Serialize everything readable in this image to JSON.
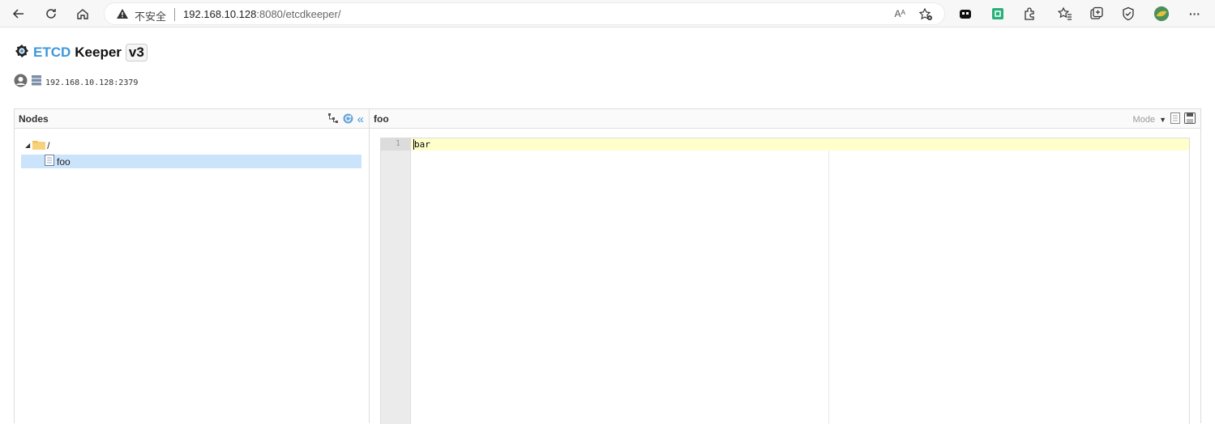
{
  "browser": {
    "insecure_label": "不安全",
    "url_host": "192.168.10.128",
    "url_rest": ":8080/etcdkeeper/",
    "read_aloud": "Aᴬ",
    "more": "···"
  },
  "app": {
    "title_etcd": "ETCD",
    "title_keeper": "Keeper",
    "version": "v3",
    "host": "192.168.10.128:2379"
  },
  "nodes_panel": {
    "title": "Nodes",
    "collapse": "«",
    "root_label": "/",
    "items": [
      {
        "label": "foo",
        "selected": true
      }
    ]
  },
  "editor_panel": {
    "title": "foo",
    "mode_label": "Mode",
    "line_numbers": [
      "1"
    ],
    "content": "bar"
  },
  "colors": {
    "accent": "#3e97db",
    "selected_row": "#cbe4fb",
    "active_line": "#ffffcc"
  }
}
